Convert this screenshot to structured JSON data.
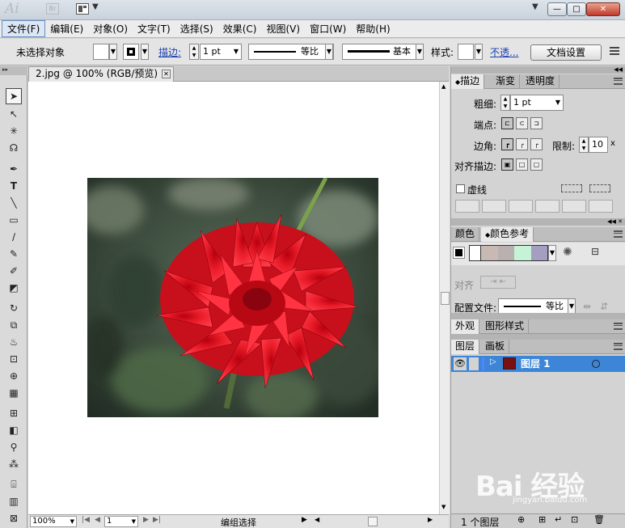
{
  "titlebar": {
    "app_logo": "Ai",
    "bridge_label": "Br",
    "min_glyph": "—",
    "max_glyph": "□",
    "close_glyph": "✕"
  },
  "menu": {
    "items": [
      "文件(F)",
      "编辑(E)",
      "对象(O)",
      "文字(T)",
      "选择(S)",
      "效果(C)",
      "视图(V)",
      "窗口(W)",
      "帮助(H)"
    ]
  },
  "controlbar": {
    "no_selection": "未选择对象",
    "stroke_label": "描边:",
    "stroke_weight": "1 pt",
    "profile_label": "等比",
    "brush_label": "基本",
    "style_label": "样式:",
    "opacity_link": "不透...",
    "doc_setup": "文档设置"
  },
  "document": {
    "tab_title": "2.jpg @ 100% (RGB/预览)",
    "tab_close": "✕"
  },
  "statusbar": {
    "zoom": "100%",
    "artboard": "1",
    "status_text": "编组选择"
  },
  "stroke_panel": {
    "tabs": [
      "描边",
      "渐变",
      "透明度"
    ],
    "weight_label": "粗细:",
    "weight_value": "1 pt",
    "cap_label": "端点:",
    "corner_label": "边角:",
    "limit_label": "限制:",
    "limit_value": "10",
    "limit_unit": "x",
    "align_label": "对齐描边:",
    "dashed_label": "虚线"
  },
  "color_panel": {
    "tabs": [
      "颜色",
      "颜色参考"
    ],
    "align_label": "对齐",
    "profile_label": "配置文件:",
    "profile_value": "等比"
  },
  "appearance_panel": {
    "tabs": [
      "外观",
      "图形样式"
    ]
  },
  "layers_panel": {
    "tabs": [
      "图层",
      "画板"
    ],
    "layer_name": "图层 1",
    "footer_count": "1 个图层"
  },
  "watermark": {
    "logo": "Bai 经验",
    "url": "jingyan.baidu.com"
  },
  "colors": {
    "selection_blue": "#3d85d6",
    "flower_red": "#e0101e",
    "guide_swatches": [
      "#c9b9b3",
      "#b8b1b0",
      "#c6f2d6",
      "#a39ec2"
    ]
  }
}
